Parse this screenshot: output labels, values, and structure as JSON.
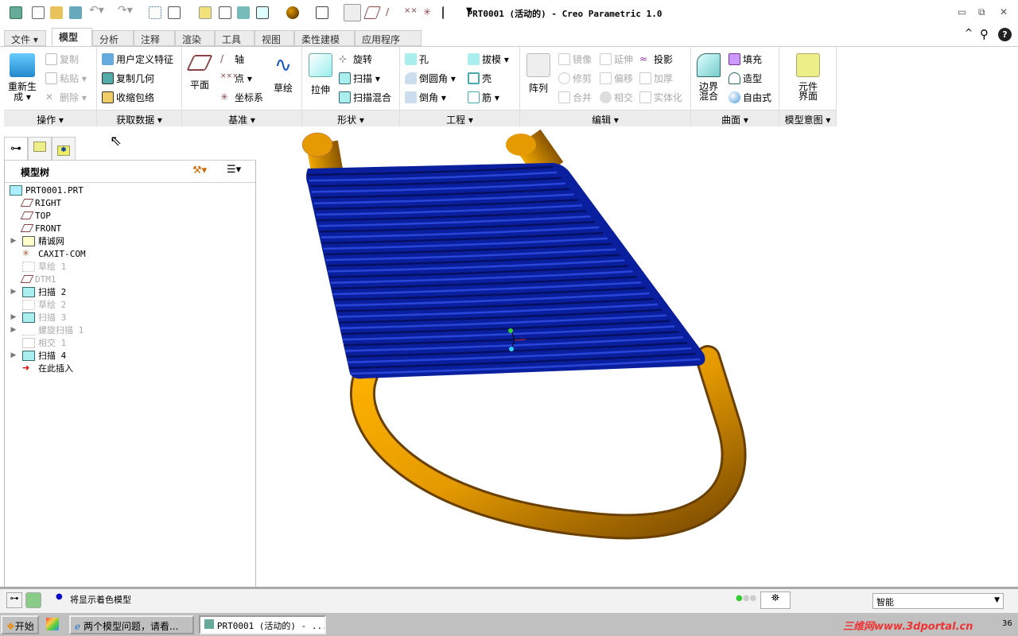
{
  "window": {
    "title": "PRT0001 (活动的) - Creo Parametric 1.0",
    "minimize": "▭",
    "restore": "⧉",
    "close": "✕"
  },
  "quick_access": {
    "icons": [
      "app-icon",
      "new-icon",
      "open-icon",
      "save-icon",
      "undo-icon",
      "redo-icon",
      "regenerate-icon",
      "windows-icon",
      "close-window-icon",
      "annotation-icon",
      "repaint-icon",
      "shading-icon",
      "appearance-icon",
      "saved-view-icon",
      "datum-display-icon",
      "plane-display-icon",
      "axis-display-icon",
      "point-display-icon",
      "csys-display-icon",
      "customize-icon"
    ]
  },
  "tabs": [
    {
      "label": "文件 ▾"
    },
    {
      "label": "模型",
      "active": true
    },
    {
      "label": "分析"
    },
    {
      "label": "注释"
    },
    {
      "label": "渲染"
    },
    {
      "label": "工具"
    },
    {
      "label": "视图"
    },
    {
      "label": "柔性建模"
    },
    {
      "label": "应用程序"
    }
  ],
  "ribbon_right": {
    "collapse": "^",
    "search": "⚲",
    "help": "?"
  },
  "groups": {
    "operations": {
      "label": "操作 ▾",
      "regenerate": "重新生成 ▾",
      "copy": "复制",
      "paste": "粘贴 ▾",
      "delete": "删除 ▾"
    },
    "get_data": {
      "label": "获取数据 ▾",
      "udf": "用户定义特征",
      "copy_geom": "复制几何",
      "shrinkwrap": "收缩包络"
    },
    "datum": {
      "label": "基准 ▾",
      "plane": "平面",
      "axis": "轴",
      "point": "点 ▾",
      "csys": "坐标系",
      "sketch": "草绘"
    },
    "shape": {
      "label": "形状 ▾",
      "extrude": "拉伸",
      "revolve": "旋转",
      "sweep": "扫描 ▾",
      "swept_blend": "扫描混合"
    },
    "engineering": {
      "label": "工程 ▾",
      "hole": "孔",
      "round": "倒圆角 ▾",
      "chamfer": "倒角 ▾",
      "draft": "拔模 ▾",
      "shell": "壳",
      "rib": "筋 ▾"
    },
    "editing": {
      "label": "编辑 ▾",
      "pattern": "阵列",
      "mirror": "镜像",
      "extend": "延伸",
      "project": "投影",
      "trim": "修剪",
      "offset": "偏移",
      "thicken": "加厚",
      "merge": "合并",
      "intersect": "相交",
      "solidify": "实体化"
    },
    "surfaces": {
      "label": "曲面 ▾",
      "boundary_blend": "边界混合",
      "fill": "填充",
      "style": "造型",
      "freestyle": "自由式"
    },
    "model_intent": {
      "label": "模型意图 ▾",
      "component_interface": "元件界面"
    }
  },
  "model_tree": {
    "title": "模型树",
    "items": [
      {
        "label": "PRT0001.PRT",
        "icon": "part-icon",
        "expand": false,
        "grey": false,
        "indent": 0
      },
      {
        "label": "RIGHT",
        "icon": "datum-plane-icon",
        "expand": false,
        "grey": false,
        "indent": 1
      },
      {
        "label": "TOP",
        "icon": "datum-plane-icon",
        "expand": false,
        "grey": false,
        "indent": 1
      },
      {
        "label": "FRONT",
        "icon": "datum-plane-icon",
        "expand": false,
        "grey": false,
        "indent": 1
      },
      {
        "label": "精诚网",
        "icon": "copied-geometry-icon",
        "expand": true,
        "grey": false,
        "indent": 1
      },
      {
        "label": "CAXIT-COM",
        "icon": "csys-icon",
        "expand": false,
        "grey": false,
        "indent": 1
      },
      {
        "label": "草绘 1",
        "icon": "sketch-icon",
        "expand": false,
        "grey": true,
        "indent": 1
      },
      {
        "label": "DTM1",
        "icon": "datum-plane-icon",
        "expand": false,
        "grey": true,
        "indent": 1
      },
      {
        "label": "扫描 2",
        "icon": "sweep-icon",
        "expand": true,
        "grey": false,
        "indent": 1
      },
      {
        "label": "草绘 2",
        "icon": "sketch-icon",
        "expand": false,
        "grey": true,
        "indent": 1
      },
      {
        "label": "扫描 3",
        "icon": "sweep-icon",
        "expand": true,
        "grey": true,
        "indent": 1
      },
      {
        "label": "螺旋扫描 1",
        "icon": "helical-sweep-icon",
        "expand": true,
        "grey": true,
        "indent": 1
      },
      {
        "label": "相交 1",
        "icon": "intersect-icon",
        "expand": false,
        "grey": true,
        "indent": 1
      },
      {
        "label": "扫描 4",
        "icon": "sweep-icon",
        "expand": true,
        "grey": false,
        "indent": 1
      },
      {
        "label": "在此插入",
        "icon": "insert-here-icon",
        "expand": false,
        "grey": false,
        "indent": 1
      }
    ]
  },
  "status": {
    "message": "将显示着色模型",
    "filter": "智能"
  },
  "taskbar": {
    "start": "开始",
    "tasks": [
      "两个模型问题，请看...",
      "PRT0001 (活动的) - ..."
    ],
    "watermark": "三维网www.3dportal.cn",
    "clock": "36"
  },
  "colors": {
    "sheet": "#0a1f9e",
    "tube": "#e49a00",
    "accent": "#1a4fa0"
  }
}
